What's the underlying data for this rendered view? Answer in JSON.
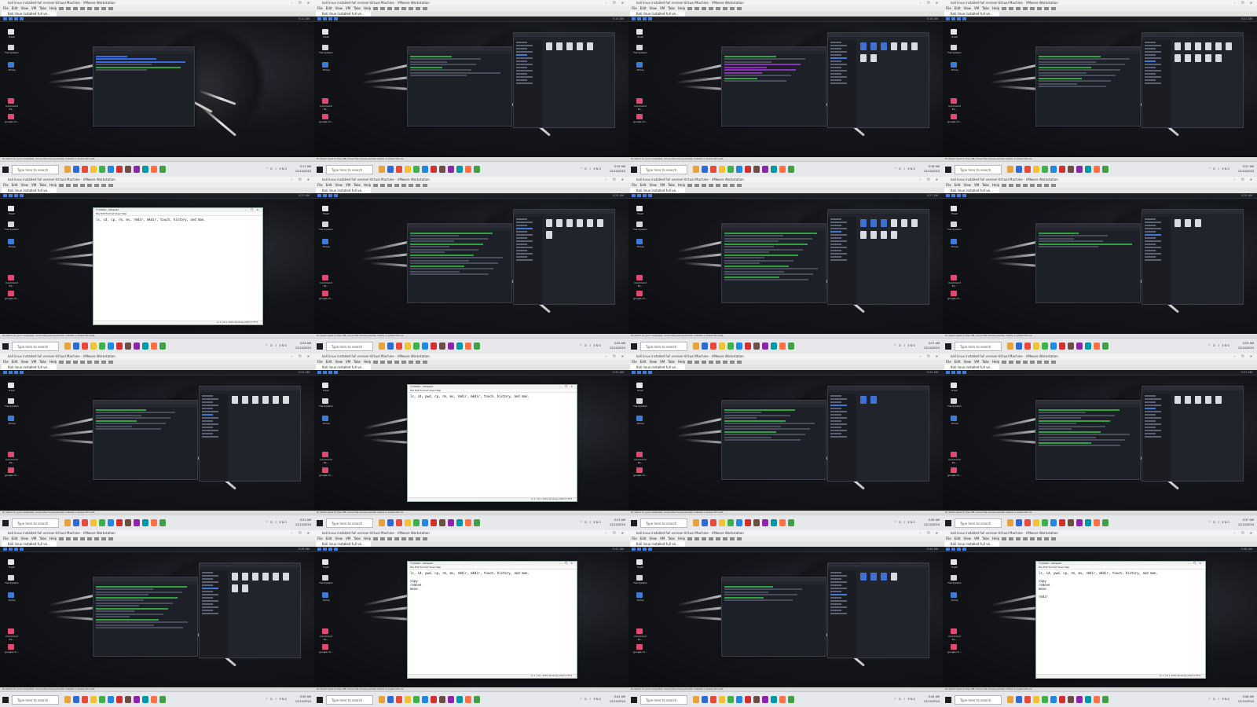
{
  "window": {
    "title": "kali linux installed full version-Virtual Machine - VMware Workstation",
    "controls": "–  ❐  ✕"
  },
  "vmware_menu": [
    "File",
    "Edit",
    "View",
    "VM",
    "Tabs",
    "Help"
  ],
  "vm_tab": "Kali linux installed full ve...",
  "status_hint": "To direct input to this VM, move the mouse pointer inside or press Ctrl+G.",
  "status_hint_alt": "To return to your computer, move the mouse pointer outside or press Ctrl+Alt.",
  "taskbar": {
    "search_placeholder": "Type here to search",
    "tray": "^  ⊡  ♪  ENG",
    "date": "12/14/2024",
    "times": [
      "5:11 AM",
      "5:15 AM",
      "5:18 AM",
      "5:21 AM",
      "5:23 AM",
      "5:25 AM",
      "5:27 AM",
      "5:29 AM",
      "5:31 AM",
      "5:33 AM",
      "5:35 AM",
      "5:37 AM",
      "5:39 AM",
      "5:41 AM",
      "5:44 AM",
      "5:46 AM"
    ]
  },
  "desktop_icons": [
    "Trash",
    "File System",
    "Home",
    "Command Ex...",
    "google-ch..."
  ],
  "notepad": {
    "title": "*Untitled - Notepad",
    "menu": [
      "File",
      "Edit",
      "Format",
      "View",
      "Help"
    ],
    "text_first": "ls, cd, cp, rm, mv, rmdir, mkdir, touch, history, and man.",
    "text_full": "ls, cd, pwd, cp, rm, mv, rmdir, mkdir, touch, history, and man.",
    "text_later": "ls, cd, pwd, cp, rm, mv, rmdir, mkdir, touch, history, and man.\n\ncopy\nremove\nmove",
    "text_last": "ls, cd, pwd, cp, rm, mv, rmdir, mkdir, touch, history, and man.\n\ncopy\nremove\nmove\n\nrmdir",
    "status": "Ln 1, Col 1     100%     Windows (CRLF)     UTF-8"
  },
  "colors": {
    "taskbar": "#e7e8ec",
    "kali_accent": "#3d7bd6",
    "terminal_bg": "#1e2027"
  }
}
